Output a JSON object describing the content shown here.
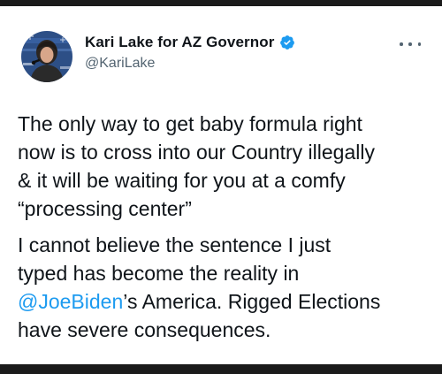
{
  "tweet": {
    "author": {
      "display_name": "Kari Lake for AZ Governor",
      "handle": "@KariLake",
      "verified": true,
      "avatar_icon": "profile-photo",
      "verified_icon": "verified-badge-icon"
    },
    "menu_icon": "more-options-icon",
    "text": {
      "line_1": "The only way to get baby formula right",
      "line_2": "now is to cross into our Country illegally",
      "line_3": "& it will be waiting for you at a comfy",
      "line_4": "“processing center”",
      "para_2_line_1": "I cannot believe the sentence I just",
      "para_2_line_2": "typed has become the reality in",
      "mention": "@JoeBiden",
      "para_2_line_3_rest": "’s America. Rigged Elections",
      "para_2_line_4": "have severe consequences."
    }
  },
  "colors": {
    "text": "#0f1419",
    "secondary": "#536471",
    "accent": "#1d9bf0",
    "frame": "#1b1b1b"
  }
}
